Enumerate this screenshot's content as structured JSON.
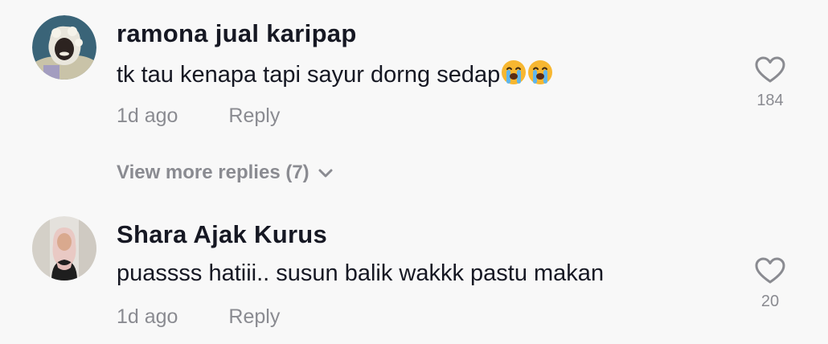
{
  "comments": [
    {
      "username": "ramona jual karipap",
      "text": "tk tau kenapa tapi sayur dorng sedap",
      "emoji": [
        "loudly-crying-face",
        "loudly-crying-face"
      ],
      "age": "1d ago",
      "reply_label": "Reply",
      "likes": "184"
    },
    {
      "username": "Shara Ajak Kurus",
      "text": "puassss hatiii.. susun balik wakkk pastu makan",
      "emoji": [],
      "age": "1d ago",
      "reply_label": "Reply",
      "likes": "20"
    }
  ],
  "view_more_replies": "View more replies (7)",
  "icons": {
    "like": "heart-outline-icon",
    "expand": "chevron-down-icon"
  },
  "colors": {
    "background": "#f8f8f8",
    "text_primary": "#161823",
    "text_secondary": "#8a8b91",
    "emoji_face": "#f7b731"
  }
}
